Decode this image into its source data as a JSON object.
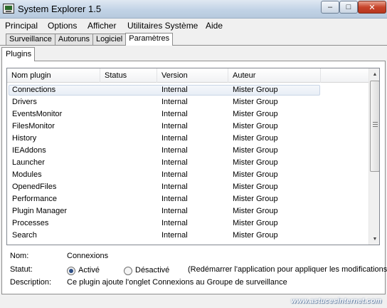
{
  "window": {
    "title": "System Explorer 1.5",
    "minimize_label": "‒",
    "maximize_label": "□",
    "close_label": "✕"
  },
  "menu": [
    "Principal",
    "Options",
    "Afficher",
    "Utilitaires Système",
    "Aide"
  ],
  "tabs": [
    {
      "label": "Surveillance",
      "active": false
    },
    {
      "label": "Autoruns",
      "active": false
    },
    {
      "label": "Logiciel",
      "active": false
    },
    {
      "label": "Paramètres",
      "active": true
    }
  ],
  "subtab": "Plugins",
  "plugin_list": {
    "columns": [
      "Nom plugin",
      "Status",
      "Version",
      "Auteur"
    ],
    "selected_index": 0,
    "rows": [
      {
        "name": "Connections",
        "status": "",
        "version": "Internal",
        "author": "Mister Group"
      },
      {
        "name": "Drivers",
        "status": "",
        "version": "Internal",
        "author": "Mister Group"
      },
      {
        "name": "EventsMonitor",
        "status": "",
        "version": "Internal",
        "author": "Mister Group"
      },
      {
        "name": "FilesMonitor",
        "status": "",
        "version": "Internal",
        "author": "Mister Group"
      },
      {
        "name": "History",
        "status": "",
        "version": "Internal",
        "author": "Mister Group"
      },
      {
        "name": "IEAddons",
        "status": "",
        "version": "Internal",
        "author": "Mister Group"
      },
      {
        "name": "Launcher",
        "status": "",
        "version": "Internal",
        "author": "Mister Group"
      },
      {
        "name": "Modules",
        "status": "",
        "version": "Internal",
        "author": "Mister Group"
      },
      {
        "name": "OpenedFiles",
        "status": "",
        "version": "Internal",
        "author": "Mister Group"
      },
      {
        "name": "Performance",
        "status": "",
        "version": "Internal",
        "author": "Mister Group"
      },
      {
        "name": "Plugin Manager",
        "status": "",
        "version": "Internal",
        "author": "Mister Group"
      },
      {
        "name": "Processes",
        "status": "",
        "version": "Internal",
        "author": "Mister Group"
      },
      {
        "name": "Search",
        "status": "",
        "version": "Internal",
        "author": "Mister Group"
      }
    ]
  },
  "details": {
    "name_label": "Nom:",
    "name_value": "Connexions",
    "status_label": "Statut:",
    "option_active": "Activé",
    "option_inactive": "Désactivé",
    "active_selected": true,
    "restart_note": "(Redémarrer l'application pour appliquer les modifications)",
    "description_label": "Description:",
    "description_value": "Ce plugin ajoute l'onglet Connexions au Groupe de surveillance"
  },
  "watermark": "www.astucesinternet.com"
}
